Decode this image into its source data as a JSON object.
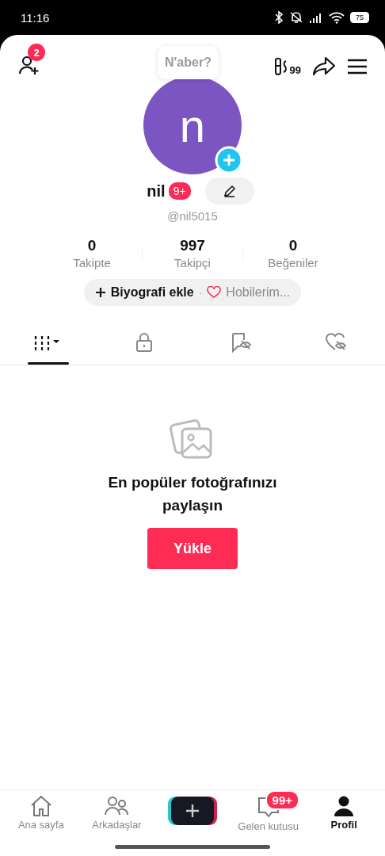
{
  "status_bar": {
    "time": "11:16",
    "battery": "75"
  },
  "header": {
    "friend_badge": "2",
    "story_bubble": "N'aber?",
    "counter": "99"
  },
  "profile": {
    "avatar_letter": "n",
    "name": "nil",
    "name_badge": "9+",
    "handle": "@nil5015"
  },
  "stats": [
    {
      "value": "0",
      "label": "Takipte"
    },
    {
      "value": "997",
      "label": "Takipçi"
    },
    {
      "value": "0",
      "label": "Beğeniler"
    }
  ],
  "bio_chip": {
    "label": "Biyografi ekle",
    "separator": "·",
    "hobbies": "Hobilerim..."
  },
  "tabs": [
    {
      "kind": "grid",
      "selected": true
    },
    {
      "kind": "lock",
      "selected": false
    },
    {
      "kind": "saved",
      "selected": false
    },
    {
      "kind": "liked",
      "selected": false
    }
  ],
  "empty_state": {
    "title": "En popüler fotoğrafınızı paylaşın",
    "button": "Yükle"
  },
  "nav": [
    {
      "kind": "home",
      "label": "Ana sayfa",
      "selected": false
    },
    {
      "kind": "friends",
      "label": "Arkadaşlar",
      "selected": false
    },
    {
      "kind": "create"
    },
    {
      "kind": "inbox",
      "label": "Gelen kutusu",
      "badge": "99+",
      "selected": false
    },
    {
      "kind": "profile",
      "label": "Profil",
      "selected": true
    }
  ]
}
